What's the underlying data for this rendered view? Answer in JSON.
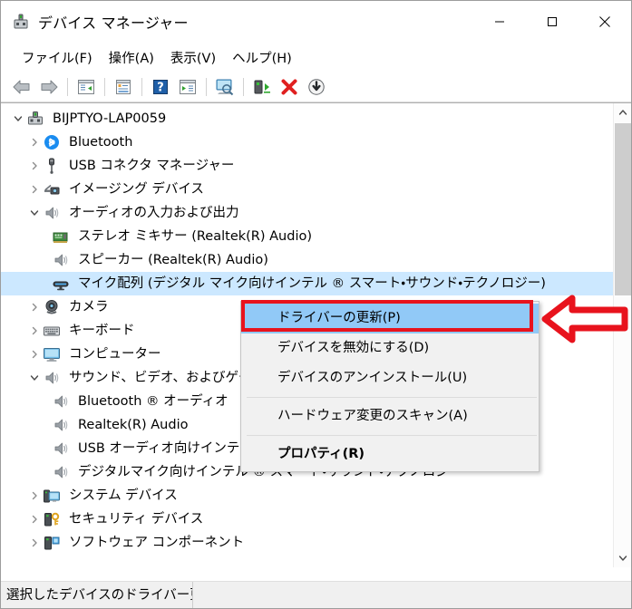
{
  "window": {
    "title": "デバイス マネージャー",
    "icon": "device-manager-icon",
    "controls": {
      "minimize": "最小化",
      "maximize": "最大化",
      "close": "閉じる"
    }
  },
  "menubar": {
    "items": [
      {
        "label": "ファイル(F)",
        "name": "menu-file"
      },
      {
        "label": "操作(A)",
        "name": "menu-action"
      },
      {
        "label": "表示(V)",
        "name": "menu-view"
      },
      {
        "label": "ヘルプ(H)",
        "name": "menu-help"
      }
    ]
  },
  "toolbar": {
    "buttons": [
      {
        "name": "back-icon",
        "tooltip": "戻る"
      },
      {
        "name": "forward-icon",
        "tooltip": "進む"
      },
      {
        "name": "show-hide-console-tree-icon",
        "tooltip": "コンソール ツリーの表示/非表示"
      },
      {
        "name": "properties-icon",
        "tooltip": "プロパティ"
      },
      {
        "name": "help-icon",
        "tooltip": "ヘルプ"
      },
      {
        "name": "show-hide-action-pane-icon",
        "tooltip": "操作ウィンドウの表示/非表示"
      },
      {
        "name": "scan-hardware-changes-icon",
        "tooltip": "ハードウェア変更のスキャン"
      },
      {
        "name": "update-driver-icon",
        "tooltip": "ドライバーの更新"
      },
      {
        "name": "uninstall-device-icon",
        "tooltip": "デバイスのアンインストール"
      },
      {
        "name": "disable-device-icon",
        "tooltip": "デバイスを無効にする"
      }
    ]
  },
  "tree": {
    "rows": [
      {
        "label": "BIJPTYO-LAP0059",
        "indent": 0,
        "expander": "expanded",
        "icon": "computer-root-icon",
        "selected": false
      },
      {
        "label": "Bluetooth",
        "indent": 1,
        "expander": "collapsed",
        "icon": "bluetooth-icon",
        "selected": false
      },
      {
        "label": "USB コネクタ マネージャー",
        "indent": 1,
        "expander": "collapsed",
        "icon": "usb-connector-icon",
        "selected": false
      },
      {
        "label": "イメージング デバイス",
        "indent": 1,
        "expander": "collapsed",
        "icon": "imaging-device-icon",
        "selected": false
      },
      {
        "label": "オーディオの入力および出力",
        "indent": 1,
        "expander": "expanded",
        "icon": "speaker-icon",
        "selected": false
      },
      {
        "label": "ステレオ ミキサー (Realtek(R) Audio)",
        "indent": 2,
        "expander": "none",
        "icon": "audio-card-icon",
        "selected": false
      },
      {
        "label": "スピーカー (Realtek(R) Audio)",
        "indent": 2,
        "expander": "none",
        "icon": "speaker-icon",
        "selected": false
      },
      {
        "label": "マイク配列 (デジタル マイク向けインテル ® スマート・サウンド・テクノロジー)",
        "indent": 2,
        "expander": "none",
        "icon": "microphone-array-icon",
        "selected": true
      },
      {
        "label": "カメラ",
        "indent": 1,
        "expander": "collapsed",
        "icon": "camera-icon",
        "selected": false
      },
      {
        "label": "キーボード",
        "indent": 1,
        "expander": "collapsed",
        "icon": "keyboard-icon",
        "selected": false
      },
      {
        "label": "コンピューター",
        "indent": 1,
        "expander": "collapsed",
        "icon": "monitor-icon",
        "selected": false
      },
      {
        "label": "サウンド、ビデオ、およびゲーム コントローラー",
        "indent": 1,
        "expander": "expanded",
        "icon": "speaker-icon",
        "selected": false
      },
      {
        "label": "Bluetooth ® オーディオ",
        "indent": 2,
        "expander": "none",
        "icon": "speaker-icon",
        "selected": false
      },
      {
        "label": "Realtek(R) Audio",
        "indent": 2,
        "expander": "none",
        "icon": "speaker-icon",
        "selected": false
      },
      {
        "label": "USB オーディオ向けインテル ® スマート・サウンド・テクノロジー",
        "indent": 2,
        "expander": "none",
        "icon": "speaker-icon",
        "selected": false
      },
      {
        "label": "デジタルマイク向けインテル ® スマート・サウンド・テクノロジー",
        "indent": 2,
        "expander": "none",
        "icon": "speaker-icon",
        "selected": false
      },
      {
        "label": "システム デバイス",
        "indent": 1,
        "expander": "collapsed",
        "icon": "system-device-icon",
        "selected": false
      },
      {
        "label": "セキュリティ デバイス",
        "indent": 1,
        "expander": "collapsed",
        "icon": "security-device-icon",
        "selected": false
      },
      {
        "label": "ソフトウェア コンポーネント",
        "indent": 1,
        "expander": "collapsed",
        "icon": "software-component-icon",
        "selected": false
      }
    ]
  },
  "context_menu": {
    "items": [
      {
        "label": "ドライバーの更新(P)",
        "name": "ctx-update-driver",
        "highlight": true,
        "bold": false,
        "separator_after": false
      },
      {
        "label": "デバイスを無効にする(D)",
        "name": "ctx-disable-device",
        "highlight": false,
        "bold": false,
        "separator_after": false
      },
      {
        "label": "デバイスのアンインストール(U)",
        "name": "ctx-uninstall-device",
        "highlight": false,
        "bold": false,
        "separator_after": true
      },
      {
        "label": "ハードウェア変更のスキャン(A)",
        "name": "ctx-scan-hardware-changes",
        "highlight": false,
        "bold": false,
        "separator_after": true
      },
      {
        "label": "プロパティ(R)",
        "name": "ctx-properties",
        "highlight": false,
        "bold": true,
        "separator_after": false
      }
    ]
  },
  "statusbar": {
    "text": "選択したデバイスのドライバー更"
  },
  "annotations": {
    "highlight_box_color": "#e8131d",
    "arrow_color": "#e8131d",
    "arrow_direction": "left"
  },
  "colors": {
    "selection_blue": "#cce8ff",
    "menu_highlight_blue": "#91c9f7",
    "window_bg": "#ffffff",
    "menu_bg": "#f1f1f1",
    "statusbar_bg": "#f0f0f0"
  }
}
